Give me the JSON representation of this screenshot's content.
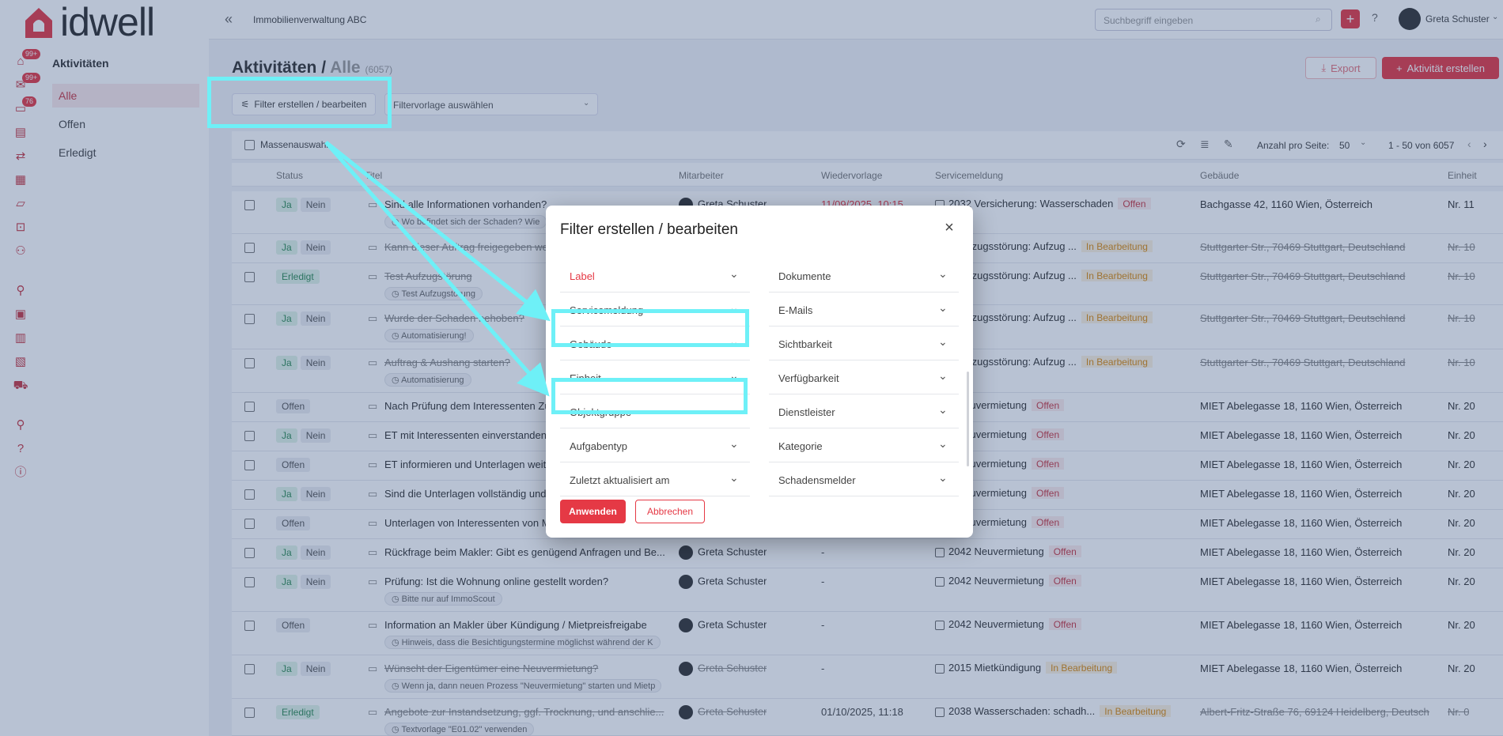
{
  "brand": {
    "name": "idwell",
    "color": "#e53945"
  },
  "rail": {
    "badges": [
      "99+",
      "99+",
      "76"
    ],
    "icons": [
      "home-icon",
      "mail-icon",
      "chat-icon",
      "receipt-icon",
      "swap-icon",
      "calendar-icon",
      "folder-icon",
      "search-doc-icon",
      "group-icon",
      "user-icon",
      "chart-icon",
      "building-icon",
      "city-icon",
      "truck-icon",
      "user-edit-icon",
      "help-icon",
      "info-icon"
    ]
  },
  "subnav": {
    "title": "Aktivitäten",
    "items": [
      "Alle",
      "Offen",
      "Erledigt"
    ]
  },
  "topbar": {
    "company": "Immobilienverwaltung ABC",
    "search_placeholder": "Suchbegriff eingeben",
    "user": "Greta Schuster"
  },
  "page": {
    "title_a": "Aktivitäten /",
    "title_b": "Alle",
    "count": "(6057)",
    "export": "Export",
    "create": "Aktivität erstellen",
    "filter_btn": "Filter erstellen / bearbeiten",
    "filter_template": "Filtervorlage auswählen"
  },
  "toolbar": {
    "mass": "Massenauswahl",
    "per_page_label": "Anzahl pro Seite:",
    "per_page": "50",
    "range": "1 - 50 von 6057"
  },
  "columns": [
    "Status",
    "Titel",
    "Mitarbeiter",
    "Wiedervorlage",
    "Servicemeldung",
    "Gebäude",
    "Einheit"
  ],
  "rows": [
    {
      "s1": "Ja",
      "s2": "Nein",
      "title": "Sind alle Informationen vorhanden?",
      "sub": "Wo befindet sich der Schaden? Wie",
      "emp": "Greta Schuster",
      "wv": "11/09/2025, 10:15",
      "svc": "2032 Versicherung: Wasserschaden",
      "svcst": "Offen",
      "geb": "Bachgasse 42, 1160 Wien, Österreich",
      "ein": "Nr. 11"
    },
    {
      "s1": "Ja",
      "s2": "Nein",
      "title": "Kann dieser Auftrag freigegeben werden",
      "sub": "",
      "emp": "",
      "wv": "",
      "svc": "3 Aufzugsstörung: Aufzug ...",
      "svcst": "In Bearbeitung",
      "geb": "Stuttgarter Str., 70469 Stuttgart, Deutschland",
      "ein": "Nr. 10"
    },
    {
      "s1": "Erledigt",
      "s2": "",
      "title": "Test Aufzugstörung",
      "sub": "Test Aufzugstörung",
      "emp": "",
      "wv": "",
      "svc": "3 Aufzugsstörung: Aufzug ...",
      "svcst": "In Bearbeitung",
      "geb": "Stuttgarter Str., 70469 Stuttgart, Deutschland",
      "ein": "Nr. 10"
    },
    {
      "s1": "Ja",
      "s2": "Nein",
      "title": "Wurde der Schaden behoben?",
      "sub": "Automatisierung!",
      "emp": "",
      "wv": "",
      "svc": "3 Aufzugsstörung: Aufzug ...",
      "svcst": "In Bearbeitung",
      "geb": "Stuttgarter Str., 70469 Stuttgart, Deutschland",
      "ein": "Nr. 10"
    },
    {
      "s1": "Ja",
      "s2": "Nein",
      "title": "Auftrag & Aushang starten?",
      "sub": "Automatisierung",
      "emp": "",
      "wv": "",
      "svc": "3 Aufzugsstörung: Aufzug ...",
      "svcst": "In Bearbeitung",
      "geb": "Stuttgarter Str., 70469 Stuttgart, Deutschland",
      "ein": "Nr. 10"
    },
    {
      "s1": "Offen",
      "s2": "",
      "title": "Nach Prüfung dem Interessenten Zu",
      "sub": "",
      "emp": "",
      "wv": "",
      "svc": "2 Neuvermietung",
      "svcst": "Offen",
      "geb": "MIET Abelegasse 18, 1160 Wien, Österreich",
      "ein": "Nr. 20"
    },
    {
      "s1": "Ja",
      "s2": "Nein",
      "title": "ET mit Interessenten einverstanden?",
      "sub": "",
      "emp": "",
      "wv": "",
      "svc": "2 Neuvermietung",
      "svcst": "Offen",
      "geb": "MIET Abelegasse 18, 1160 Wien, Österreich",
      "ein": "Nr. 20"
    },
    {
      "s1": "Offen",
      "s2": "",
      "title": "ET informieren und Unterlagen weite",
      "sub": "",
      "emp": "",
      "wv": "",
      "svc": "2 Neuvermietung",
      "svcst": "Offen",
      "geb": "MIET Abelegasse 18, 1160 Wien, Österreich",
      "ein": "Nr. 20"
    },
    {
      "s1": "Ja",
      "s2": "Nein",
      "title": "Sind die Unterlagen vollständig und",
      "sub": "",
      "emp": "",
      "wv": "",
      "svc": "2 Neuvermietung",
      "svcst": "Offen",
      "geb": "MIET Abelegasse 18, 1160 Wien, Österreich",
      "ein": "Nr. 20"
    },
    {
      "s1": "Offen",
      "s2": "",
      "title": "Unterlagen von Interessenten von M",
      "sub": "",
      "emp": "",
      "wv": "",
      "svc": "2 Neuvermietung",
      "svcst": "Offen",
      "geb": "MIET Abelegasse 18, 1160 Wien, Österreich",
      "ein": "Nr. 20"
    },
    {
      "s1": "Ja",
      "s2": "Nein",
      "title": "Rückfrage beim Makler: Gibt es genügend Anfragen und Be...",
      "sub": "",
      "emp": "Greta Schuster",
      "wv": "-",
      "svc": "2042 Neuvermietung",
      "svcst": "Offen",
      "geb": "MIET Abelegasse 18, 1160 Wien, Österreich",
      "ein": "Nr. 20"
    },
    {
      "s1": "Ja",
      "s2": "Nein",
      "title": "Prüfung: Ist die Wohnung online gestellt worden?",
      "sub": "Bitte nur auf ImmoScout",
      "emp": "Greta Schuster",
      "wv": "-",
      "svc": "2042 Neuvermietung",
      "svcst": "Offen",
      "geb": "MIET Abelegasse 18, 1160 Wien, Österreich",
      "ein": "Nr. 20"
    },
    {
      "s1": "Offen",
      "s2": "",
      "title": "Information an Makler über Kündigung / Mietpreisfreigabe",
      "sub": "Hinweis, dass die Besichtigungstermine möglichst während der K",
      "emp": "Greta Schuster",
      "wv": "-",
      "svc": "2042 Neuvermietung",
      "svcst": "Offen",
      "geb": "MIET Abelegasse 18, 1160 Wien, Österreich",
      "ein": "Nr. 20"
    },
    {
      "s1": "Ja",
      "s2": "Nein",
      "title": "Wünscht der Eigentümer eine Neuvermietung?",
      "sub": "Wenn ja, dann neuen Prozess \"Neuvermietung\" starten und Mietp",
      "emp": "Greta Schuster",
      "wv": "-",
      "svc": "2015 Mietkündigung",
      "svcst": "In Bearbeitung",
      "geb": "MIET Abelegasse 18, 1160 Wien, Österreich",
      "ein": "Nr. 20"
    },
    {
      "s1": "Erledigt",
      "s2": "",
      "title": "Angebote zur Instandsetzung, ggf. Trocknung, und anschlie...",
      "sub": "Textvorlage \"E01.02\" verwenden",
      "emp": "Greta Schuster",
      "wv": "01/10/2025, 11:18",
      "svc": "2038 Wasserschaden: schadh...",
      "svcst": "In Bearbeitung",
      "geb": "Albert-Fritz-Straße 76, 69124 Heidelberg, Deutsche...",
      "ein": "Nr. 0"
    }
  ],
  "modal": {
    "title": "Filter erstellen / bearbeiten",
    "left": [
      "Label",
      "Servicemeldung",
      "Gebäude",
      "Einheit",
      "Objektgruppe",
      "Aufgabentyp",
      "Zuletzt aktualisiert am"
    ],
    "right": [
      "Dokumente",
      "E-Mails",
      "Sichtbarkeit",
      "Verfügbarkeit",
      "Dienstleister",
      "Kategorie",
      "Schadensmelder"
    ],
    "apply": "Anwenden",
    "cancel": "Abbrechen"
  },
  "colors": {
    "accent": "#e53945",
    "highlight": "#6ef0f7"
  }
}
